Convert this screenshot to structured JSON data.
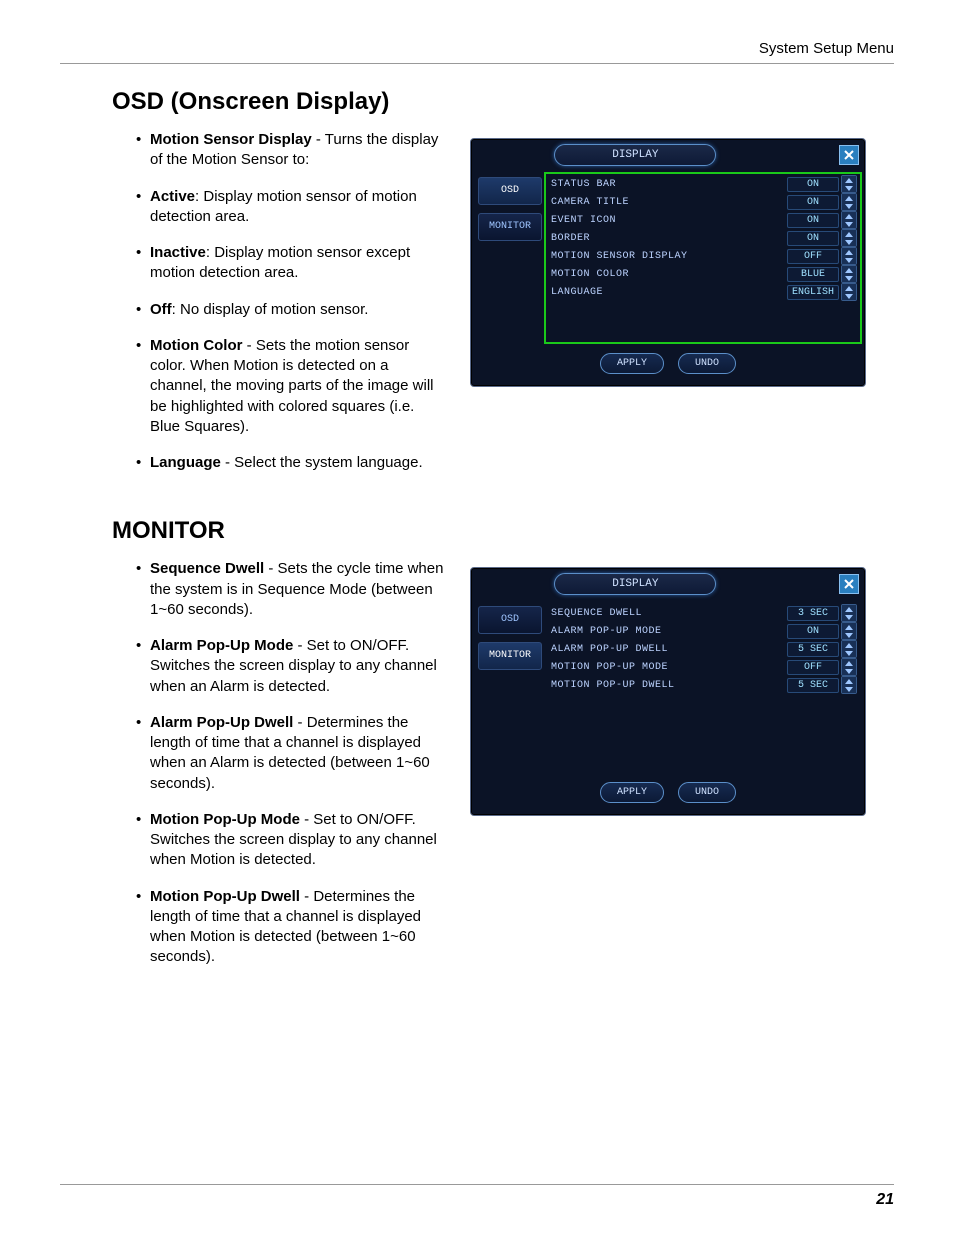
{
  "header": {
    "breadcrumb": "System Setup Menu"
  },
  "osd_section": {
    "title": "OSD (Onscreen Display)",
    "bullets": [
      {
        "b": "Motion Sensor Display",
        "t": " - Turns the display of the Motion Sensor to:"
      },
      {
        "b": "Active",
        "t": ": Display motion sensor of motion detection area."
      },
      {
        "b": "Inactive",
        "t": ": Display motion sensor except motion detection area."
      },
      {
        "b": "Off",
        "t": ": No display of motion sensor."
      },
      {
        "b": "Motion Color",
        "t": " - Sets the motion sensor color. When Motion is detected on a channel, the moving parts of the image will be highlighted with colored squares (i.e. Blue Squares)."
      },
      {
        "b": "Language",
        "t": " - Select the system language."
      }
    ],
    "panel": {
      "title": "DISPLAY",
      "apply": "APPLY",
      "undo": "UNDO",
      "tabs": [
        "OSD",
        "MONITOR"
      ],
      "active_tab": 0,
      "rows": [
        {
          "label": "STATUS BAR",
          "value": "ON"
        },
        {
          "label": "CAMERA TITLE",
          "value": "ON"
        },
        {
          "label": "EVENT ICON",
          "value": "ON"
        },
        {
          "label": "BORDER",
          "value": "ON"
        },
        {
          "label": "MOTION SENSOR DISPLAY",
          "value": "OFF"
        },
        {
          "label": "MOTION COLOR",
          "value": "BLUE"
        },
        {
          "label": "LANGUAGE",
          "value": "ENGLISH"
        }
      ]
    }
  },
  "monitor_section": {
    "title": "MONITOR",
    "bullets": [
      {
        "b": "Sequence Dwell",
        "t": " - Sets the cycle time when the system is in Sequence Mode (between 1~60 seconds)."
      },
      {
        "b": "Alarm Pop-Up Mode",
        "t": " - Set to ON/OFF. Switches the screen display to any channel when an Alarm is detected."
      },
      {
        "b": "Alarm Pop-Up Dwell",
        "t": " - Determines the length of time that a channel is displayed when an Alarm is detected (between 1~60 seconds)."
      },
      {
        "b": "Motion Pop-Up Mode",
        "t": " - Set to ON/OFF. Switches the screen display to any channel when Motion is detected."
      },
      {
        "b": "Motion Pop-Up Dwell",
        "t": " - Determines the length of time that a channel is displayed when Motion is detected (between 1~60 seconds)."
      }
    ],
    "panel": {
      "title": "DISPLAY",
      "apply": "APPLY",
      "undo": "UNDO",
      "tabs": [
        "OSD",
        "MONITOR"
      ],
      "active_tab": 1,
      "rows": [
        {
          "label": "SEQUENCE DWELL",
          "value": "3 SEC"
        },
        {
          "label": "ALARM POP-UP MODE",
          "value": "ON"
        },
        {
          "label": "ALARM POP-UP DWELL",
          "value": "5 SEC"
        },
        {
          "label": "MOTION POP-UP MODE",
          "value": "OFF"
        },
        {
          "label": "MOTION POP-UP DWELL",
          "value": "5 SEC"
        }
      ]
    }
  },
  "page_number": "21"
}
